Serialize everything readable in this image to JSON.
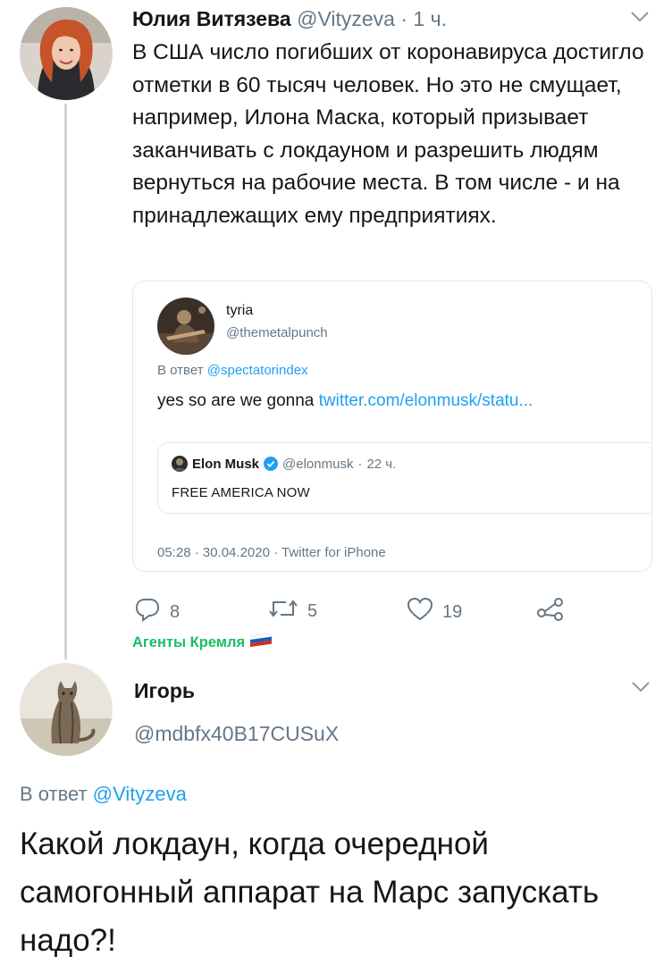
{
  "tweet1": {
    "author_name": "Юлия Витязева",
    "handle": "@Vityzeva",
    "separator": "·",
    "time": "1 ч.",
    "text": "В США число погибших от коронавируса достигло отметки в 60 тысяч человек. Но это не смущает, например, Илона Маска, который призывает заканчивать с локдауном и разрешить людям вернуться на рабочие места. В том числе - и на принадлежащих ему предприятиях."
  },
  "quote": {
    "name": "tyria",
    "handle": "@themetalpunch",
    "reply_prefix": "В ответ",
    "reply_to": "@spectatorindex",
    "text_plain": "yes so are we gonna ",
    "text_link": "twitter.com/elonmusk/statu...",
    "inner": {
      "name": "Elon Musk",
      "handle": "@elonmusk",
      "separator": "·",
      "time": "22 ч.",
      "text": "FREE AMERICA NOW"
    },
    "meta": "05:28 · 30.04.2020 · Twitter for iPhone"
  },
  "actions": {
    "replies": "8",
    "retweets": "5",
    "likes": "19"
  },
  "group_label": "Агенты Кремля",
  "tweet2": {
    "author_name": "Игорь",
    "handle": "@mdbfx40B17CUSuX",
    "reply_prefix": "В ответ",
    "reply_to": "@Vityzeva",
    "text": "Какой локдаун, когда очередной самогонный аппарат на Марс запускать надо?!"
  },
  "colors": {
    "link": "#1da1f2",
    "muted": "#657786",
    "group_label": "#17bf63",
    "verified": "#1da1f2"
  },
  "icons": [
    "chevron-down-icon",
    "reply-icon",
    "retweet-icon",
    "like-icon",
    "share-icon",
    "verified-icon",
    "russia-flag-icon"
  ]
}
